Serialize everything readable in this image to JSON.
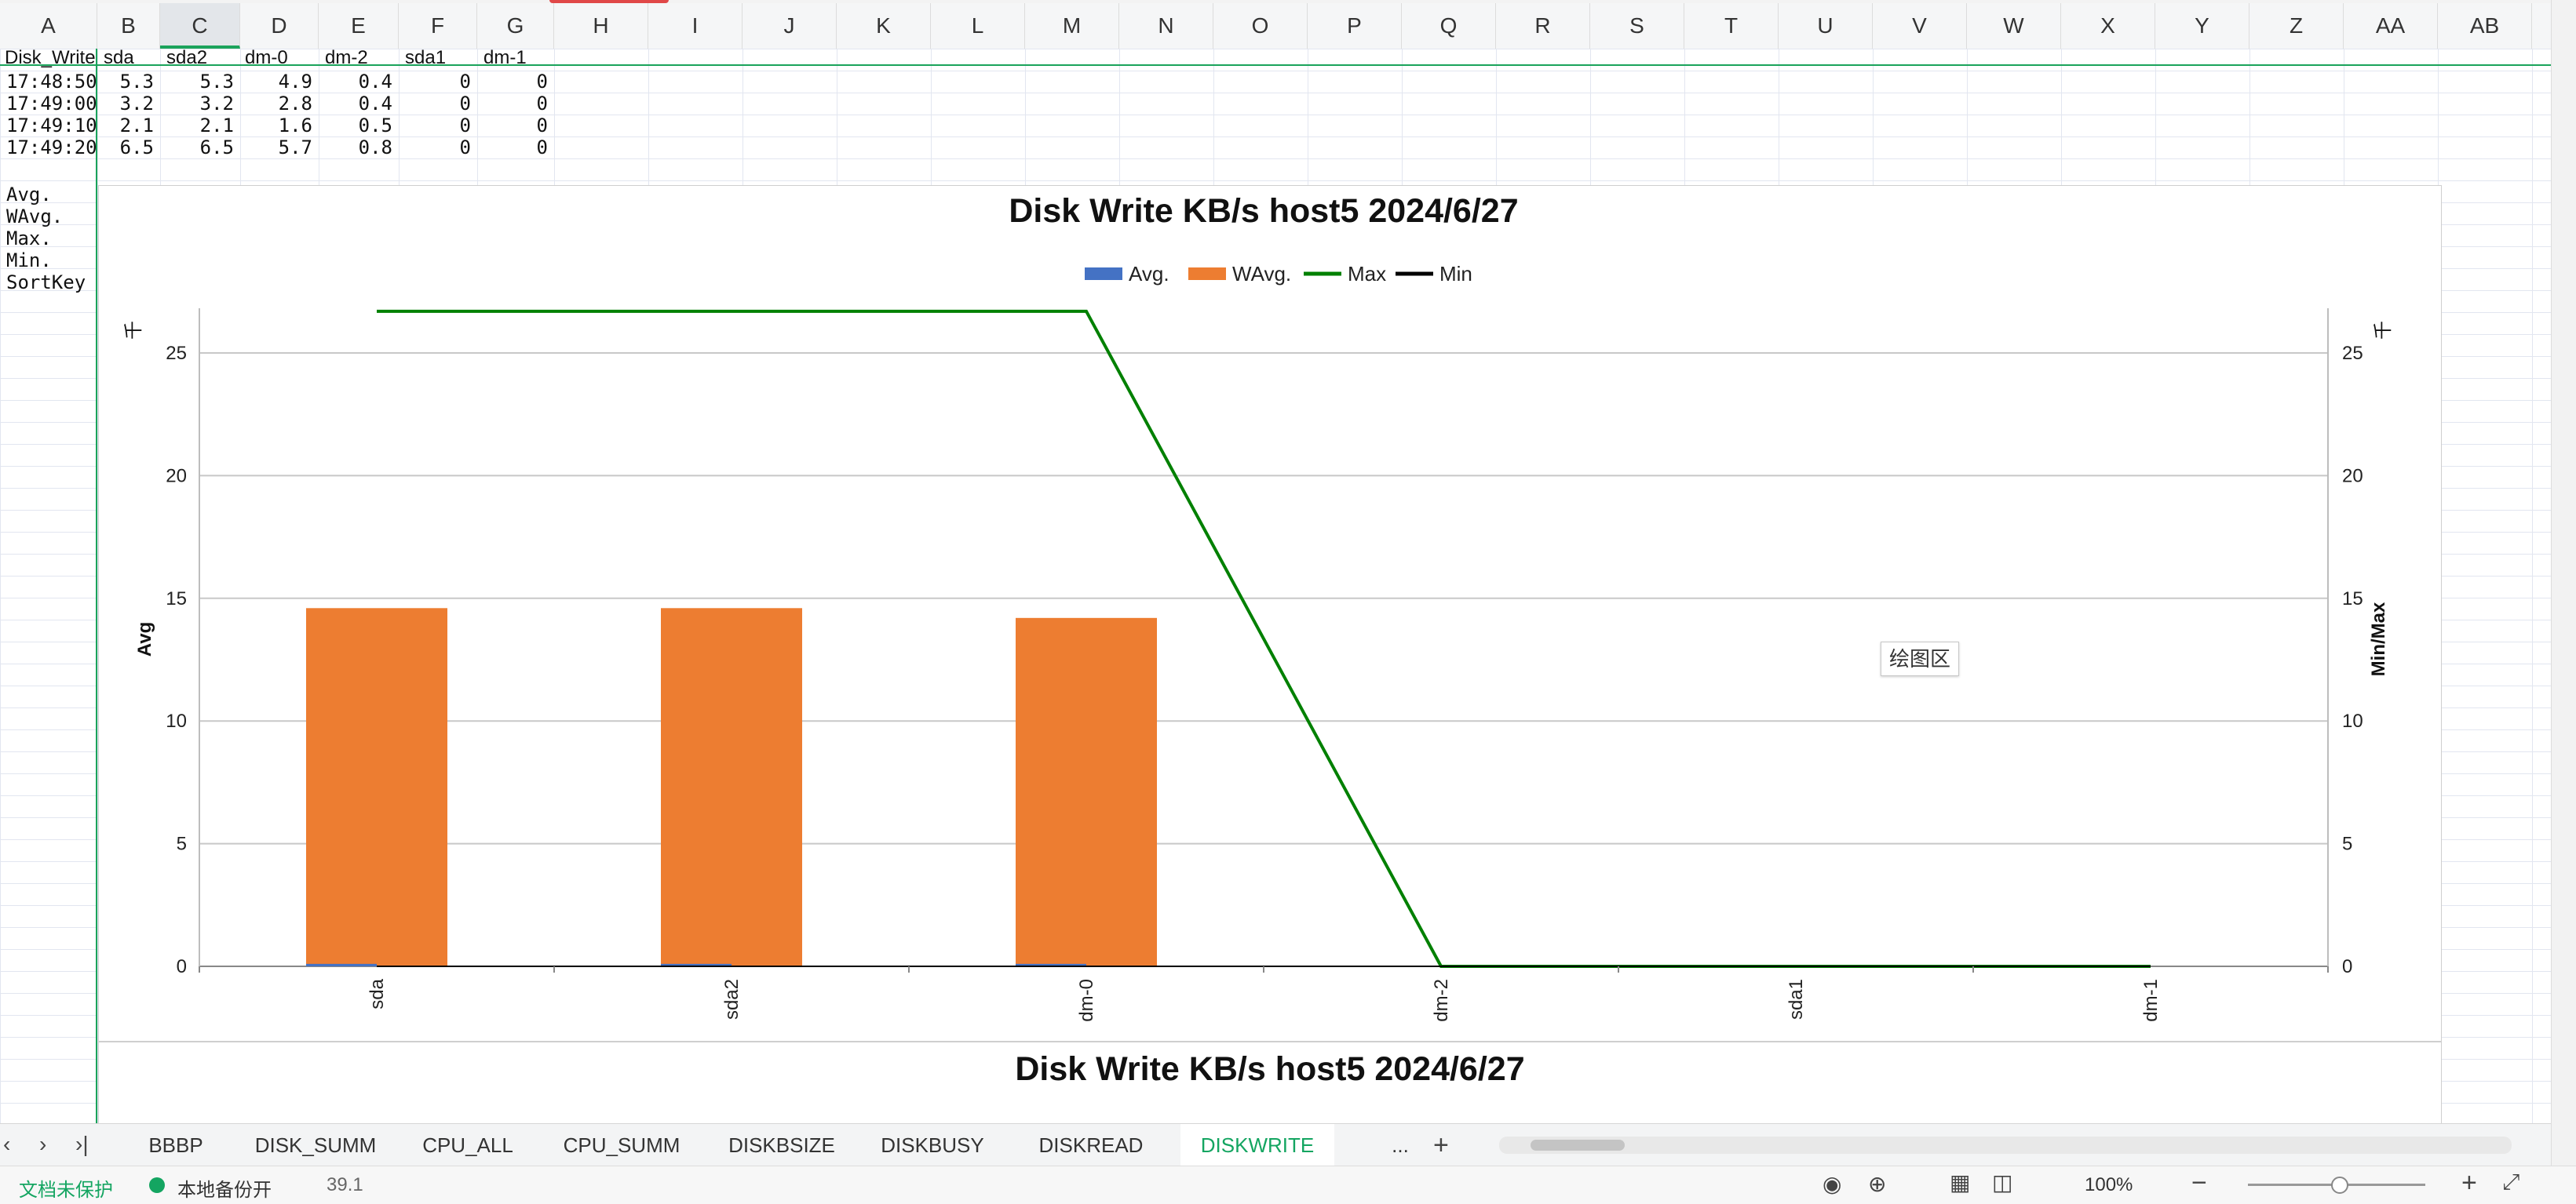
{
  "columns": [
    "A",
    "B",
    "C",
    "D",
    "E",
    "F",
    "G",
    "H",
    "I",
    "J",
    "K",
    "L",
    "M",
    "N",
    "O",
    "P",
    "Q",
    "R",
    "S",
    "T",
    "U",
    "V",
    "W",
    "X",
    "Y",
    "Z",
    "AA",
    "AB"
  ],
  "selected_column": "C",
  "header_row": [
    "Disk_Write",
    "sda",
    "sda2",
    "dm-0",
    "dm-2",
    "sda1",
    "dm-1"
  ],
  "data_rows": [
    [
      "17:48:50",
      "5.3",
      "5.3",
      "4.9",
      "0.4",
      "0",
      "0"
    ],
    [
      "17:49:00",
      "3.2",
      "3.2",
      "2.8",
      "0.4",
      "0",
      "0"
    ],
    [
      "17:49:10",
      "2.1",
      "2.1",
      "1.6",
      "0.5",
      "0",
      "0"
    ],
    [
      "17:49:20",
      "6.5",
      "6.5",
      "5.7",
      "0.8",
      "0",
      "0"
    ]
  ],
  "stat_labels": [
    "Avg.",
    "WAvg.",
    "Max.",
    "Min.",
    "SortKey"
  ],
  "chart_data": {
    "type": "bar",
    "title": "Disk Write KB/s host5  2024/6/27",
    "categories": [
      "sda",
      "sda2",
      "dm-0",
      "dm-2",
      "sda1",
      "dm-1"
    ],
    "series": [
      {
        "name": "Avg.",
        "kind": "bar",
        "axis": "left",
        "color": "#4472c4",
        "values": [
          0.1,
          0.1,
          0.1,
          0.0,
          0.0,
          0.0
        ]
      },
      {
        "name": "WAvg.",
        "kind": "bar",
        "axis": "left",
        "color": "#ed7d31",
        "values": [
          14.6,
          14.6,
          14.2,
          0.0,
          0.0,
          0.0
        ]
      },
      {
        "name": "Max",
        "kind": "line",
        "axis": "right",
        "color": "#008000",
        "values": [
          26.7,
          26.7,
          26.7,
          0.0,
          0.0,
          0.0
        ]
      },
      {
        "name": "Min",
        "kind": "line",
        "axis": "right",
        "color": "#000000",
        "values": [
          0,
          0,
          0,
          0,
          0,
          0
        ]
      }
    ],
    "ylabel": "Avg",
    "y2label": "Min/Max",
    "y_unit": "千",
    "ylim": [
      0,
      25
    ],
    "yticks": [
      0,
      5,
      10,
      15,
      20,
      25
    ],
    "legend": "top",
    "grid": true
  },
  "chart2_title": "Disk Write KB/s host5  2024/6/27",
  "tooltip": "绘图区",
  "sheet_tabs": [
    "BBBP",
    "DISK_SUMM",
    "CPU_ALL",
    "CPU_SUMM",
    "DISKBSIZE",
    "DISKBUSY",
    "DISKREAD",
    "DISKWRITE",
    "..."
  ],
  "active_tab": "DISKWRITE",
  "status": {
    "protect": "文档未保护",
    "backup": "本地备份开",
    "value": "39.1",
    "zoom": "100%"
  }
}
